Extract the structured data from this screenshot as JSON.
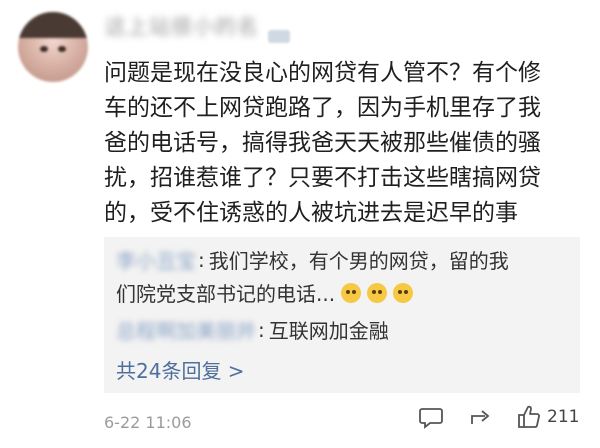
{
  "comment": {
    "username": "这上站很小的名",
    "text_lines": [
      "问题是现在没良心的网贷有人管不？有个修",
      "车的还不上网贷跑路了，因为手机里存了我",
      "爸的电话号，搞得我爸天天被那些催债的骚",
      "扰，招谁惹谁了？只要不打击这些瞎搞网贷",
      "的，受不住诱惑的人被坑进去是迟早的事"
    ],
    "timestamp": "6-22 11:06",
    "like_count": "211"
  },
  "replies": [
    {
      "author": "李小丑宝",
      "text_line1": "我们学校，有个男的网贷，留的我",
      "text_line2": "们院党支部书记的电话...",
      "emoji": "😺"
    },
    {
      "author": "总程啊加美丽并",
      "text_line1": "互联网加金融"
    }
  ],
  "more_replies_label": "共24条回复 >",
  "icons": {
    "comment": "comment-icon",
    "share": "share-icon",
    "like": "thumbs-up-icon"
  }
}
